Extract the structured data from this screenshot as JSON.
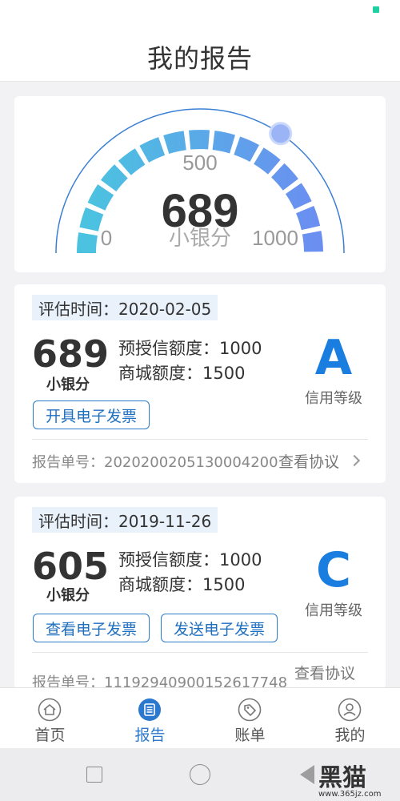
{
  "header": {
    "title": "我的报告"
  },
  "gauge": {
    "score": "689",
    "min_label": "0",
    "mid_label": "500",
    "max_label": "1000",
    "unit": "小银分",
    "score_value": 689,
    "range": [
      0,
      1000
    ]
  },
  "reports": [
    {
      "time_label": "评估时间：2020-02-05",
      "score": "689",
      "unit": "小银分",
      "credit_label": "预授信额度：1000",
      "mall_label": "商城额度：1500",
      "grade": "A",
      "grade_label": "信用等级",
      "buttons": [
        "开具电子发票"
      ],
      "report_no": "报告单号：20202002051300042​00",
      "agreement": "查看协议"
    },
    {
      "time_label": "评估时间：2019-11-26",
      "score": "605",
      "unit": "小银分",
      "credit_label": "预授信额度：1000",
      "mall_label": "商城额度：1500",
      "grade": "C",
      "grade_label": "信用等级",
      "buttons": [
        "查看电子发票",
        "发送电子发票"
      ],
      "report_no": "报告单号：11192940900152617748",
      "agreement": "查看协议"
    }
  ],
  "tabs": [
    {
      "label": "首页",
      "icon": "home-icon"
    },
    {
      "label": "报告",
      "icon": "report-icon"
    },
    {
      "label": "账单",
      "icon": "bill-tag-icon"
    },
    {
      "label": "我的",
      "icon": "profile-icon"
    }
  ],
  "active_tab": "报告",
  "watermark": {
    "text": "黑猫",
    "url": "www.365jz.com"
  },
  "colors": {
    "accent": "#2b79cf",
    "grade": "#1a7ee0",
    "gauge_start": "#4bc3e0",
    "gauge_end": "#6a8ff0"
  }
}
